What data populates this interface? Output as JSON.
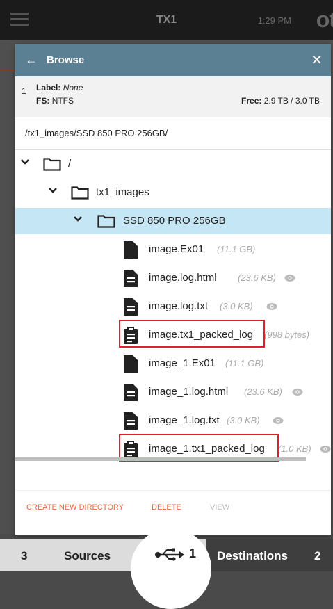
{
  "appbar": {
    "title": "TX1",
    "time": "1:29 PM",
    "logo": "ot"
  },
  "browse": {
    "title": "Browse",
    "drive": {
      "index": "1",
      "label_key": "Label:",
      "label_value": "None",
      "fs_key": "FS:",
      "fs_value": "NTFS",
      "free_key": "Free:",
      "free_value": "2.9 TB / 3.0 TB"
    },
    "path": "/tx1_images/SSD 850 PRO 256GB/",
    "tree": {
      "root": "/",
      "folder1": "tx1_images",
      "folder2": "SSD 850 PRO 256GB",
      "files": [
        {
          "name": "image.Ex01",
          "size": "(11.1 GB)",
          "icon": "file-icon",
          "eye": false
        },
        {
          "name": "image.log.html",
          "size": "(23.6 KB)",
          "icon": "document-lines-icon",
          "eye": true
        },
        {
          "name": "image.log.txt",
          "size": "(3.0 KB)",
          "icon": "document-lines-icon",
          "eye": true
        },
        {
          "name": "image.tx1_packed_log",
          "size": "(998 bytes)",
          "icon": "clipboard-icon",
          "eye": false
        },
        {
          "name": "image_1.Ex01",
          "size": "(11.1 GB)",
          "icon": "file-icon",
          "eye": false
        },
        {
          "name": "image_1.log.html",
          "size": "(23.6 KB)",
          "icon": "document-lines-icon",
          "eye": true
        },
        {
          "name": "image_1.log.txt",
          "size": "(3.0 KB)",
          "icon": "document-lines-icon",
          "eye": true
        },
        {
          "name": "image_1.tx1_packed_log",
          "size": "(1.0 KB)",
          "icon": "clipboard-icon",
          "eye": true
        }
      ]
    },
    "actions": {
      "create": "CREATE NEW DIRECTORY",
      "delete": "DELETE",
      "view": "VIEW"
    }
  },
  "bottom": {
    "sources_count": "3",
    "sources_label": "Sources",
    "usb_count": "1",
    "destinations_label": "Destinations",
    "destinations_count": "2"
  },
  "colors": {
    "header": "#5b7f93",
    "selected_row": "#c5e6f5",
    "accent": "#e8643a",
    "highlight_box": "#d9232e"
  }
}
